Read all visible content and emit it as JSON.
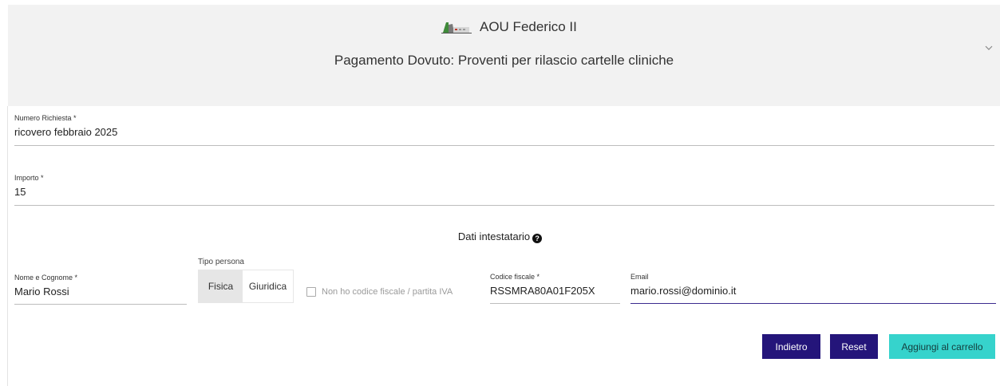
{
  "header": {
    "org_name": "AOU Federico II",
    "subject": "Pagamento Dovuto: Proventi per rilascio cartelle cliniche",
    "expand_icon": "chevron-down-icon"
  },
  "form": {
    "numero_richiesta": {
      "label": "Numero Richiesta *",
      "value": "ricovero febbraio 2025"
    },
    "importo": {
      "label": "Importo *",
      "value": "15"
    },
    "section_title": "Dati intestatario",
    "help_icon": "question-circle-icon",
    "nome": {
      "label": "Nome e Cognome *",
      "value": "Mario Rossi"
    },
    "tipo_persona": {
      "label": "Tipo persona",
      "options": [
        "Fisica",
        "Giuridica"
      ],
      "selected": "Fisica"
    },
    "no_cf": {
      "label": "Non ho codice fiscale / partita IVA",
      "checked": false
    },
    "codice_fiscale": {
      "label": "Codice fiscale *",
      "value": "RSSMRA80A01F205X"
    },
    "email": {
      "label": "Email",
      "value": "mario.rossi@dominio.it"
    }
  },
  "buttons": {
    "back": "Indietro",
    "reset": "Reset",
    "add_cart": "Aggiungi al carrello"
  },
  "colors": {
    "primary": "#24157a",
    "accent": "#36d3cc",
    "header_bg": "#f2f2f2"
  }
}
